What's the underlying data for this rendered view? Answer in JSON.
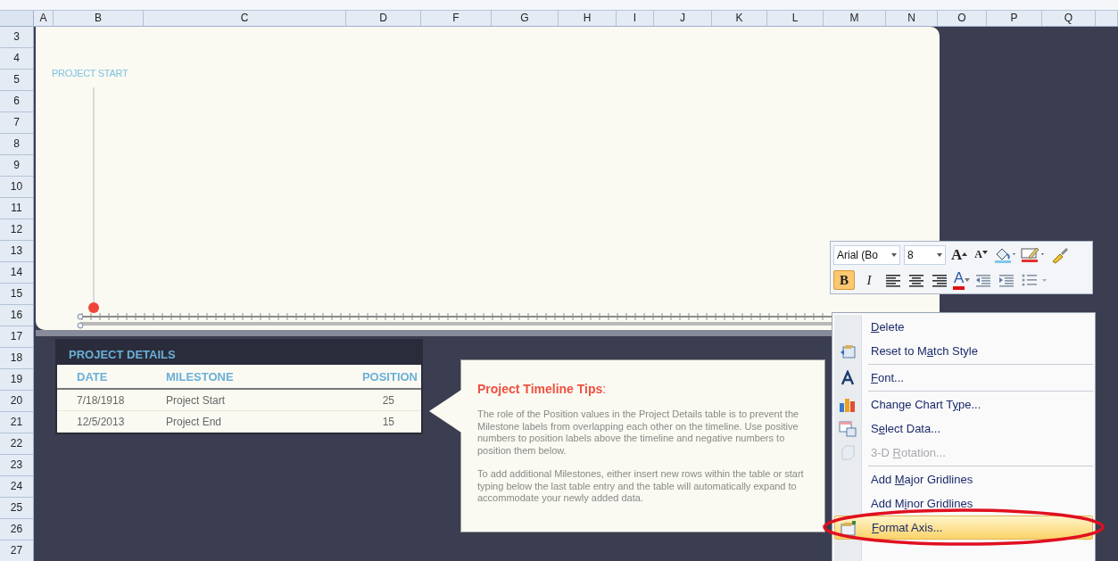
{
  "columns": [
    "A",
    "B",
    "C",
    "D",
    "F",
    "G",
    "H",
    "I",
    "J",
    "K",
    "L",
    "M",
    "N",
    "O",
    "P",
    "Q"
  ],
  "rows": [
    "3",
    "4",
    "5",
    "6",
    "7",
    "8",
    "9",
    "10",
    "11",
    "12",
    "13",
    "14",
    "15",
    "16",
    "17",
    "18",
    "19",
    "20",
    "21",
    "22",
    "23",
    "24",
    "25",
    "26",
    "27"
  ],
  "chart": {
    "milestone_label": "PROJECT START"
  },
  "table": {
    "title": "PROJECT DETAILS",
    "columns": [
      "DATE",
      "MILESTONE",
      "POSITION"
    ],
    "rows": [
      [
        "7/18/1918",
        "Project Start",
        "25"
      ],
      [
        "12/5/2013",
        "Project End",
        "15"
      ]
    ]
  },
  "tips": {
    "title": "Project Timeline  Tips",
    "colon": ":",
    "paragraphs": [
      "The role of the Position values in the Project Details table is to prevent the Milestone labels from overlapping each other on the timeline. Use positive numbers to position labels above the timeline and negative numbers to position them below.",
      "To add additional Milestones, either insert new rows  within the table or start typing below the last table entry and the table will automatically expand to accommodate your newly added data."
    ]
  },
  "mini_toolbar": {
    "font": "Arial (Bo",
    "size": "8",
    "grow": "A",
    "shrink": "A",
    "bold": {
      "label": "B",
      "on": true
    },
    "italic": {
      "label": "I",
      "on": false
    },
    "font_color": "A"
  },
  "context_menu": [
    [
      {
        "key": "D",
        "post": "elete",
        "disabled": false,
        "selected": false
      },
      {
        "pre": "Reset to M",
        "key": "a",
        "post": "tch Style",
        "disabled": false,
        "selected": false
      }
    ],
    [
      {
        "key": "F",
        "post": "ont...",
        "disabled": false,
        "selected": false
      }
    ],
    [
      {
        "pre": "Change Chart T",
        "key": "y",
        "post": "pe...",
        "disabled": false,
        "selected": false
      },
      {
        "pre": "S",
        "key": "e",
        "post": "lect Data...",
        "disabled": false,
        "selected": false
      },
      {
        "pre": "3-D ",
        "key": "R",
        "post": "otation...",
        "disabled": true,
        "selected": false
      }
    ],
    [
      {
        "pre": "Add ",
        "key": "M",
        "post": "ajor Gridlines",
        "disabled": false,
        "selected": false
      },
      {
        "pre": "Add M",
        "key": "i",
        "post": "nor Gridlines",
        "disabled": false,
        "selected": false
      },
      {
        "key": "F",
        "post": "ormat Axis...",
        "disabled": false,
        "selected": true
      }
    ]
  ]
}
